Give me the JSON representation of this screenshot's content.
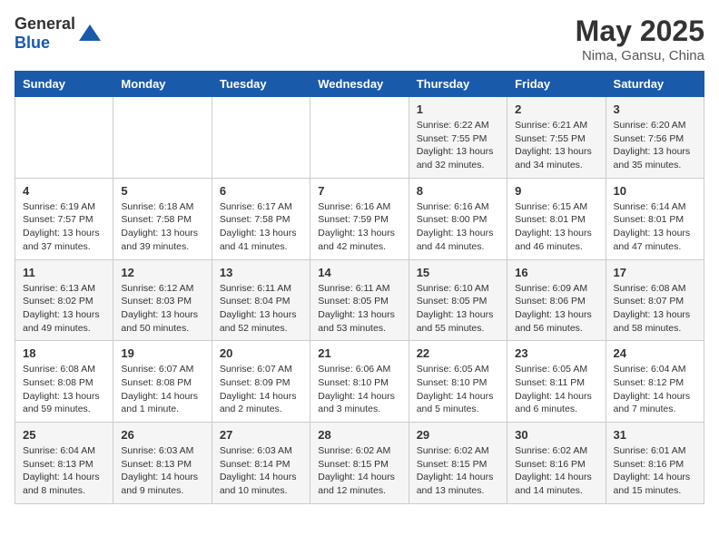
{
  "header": {
    "logo_general": "General",
    "logo_blue": "Blue",
    "month": "May 2025",
    "location": "Nima, Gansu, China"
  },
  "weekdays": [
    "Sunday",
    "Monday",
    "Tuesday",
    "Wednesday",
    "Thursday",
    "Friday",
    "Saturday"
  ],
  "weeks": [
    [
      {
        "day": "",
        "info": ""
      },
      {
        "day": "",
        "info": ""
      },
      {
        "day": "",
        "info": ""
      },
      {
        "day": "",
        "info": ""
      },
      {
        "day": "1",
        "info": "Sunrise: 6:22 AM\nSunset: 7:55 PM\nDaylight: 13 hours and 32 minutes."
      },
      {
        "day": "2",
        "info": "Sunrise: 6:21 AM\nSunset: 7:55 PM\nDaylight: 13 hours and 34 minutes."
      },
      {
        "day": "3",
        "info": "Sunrise: 6:20 AM\nSunset: 7:56 PM\nDaylight: 13 hours and 35 minutes."
      }
    ],
    [
      {
        "day": "4",
        "info": "Sunrise: 6:19 AM\nSunset: 7:57 PM\nDaylight: 13 hours and 37 minutes."
      },
      {
        "day": "5",
        "info": "Sunrise: 6:18 AM\nSunset: 7:58 PM\nDaylight: 13 hours and 39 minutes."
      },
      {
        "day": "6",
        "info": "Sunrise: 6:17 AM\nSunset: 7:58 PM\nDaylight: 13 hours and 41 minutes."
      },
      {
        "day": "7",
        "info": "Sunrise: 6:16 AM\nSunset: 7:59 PM\nDaylight: 13 hours and 42 minutes."
      },
      {
        "day": "8",
        "info": "Sunrise: 6:16 AM\nSunset: 8:00 PM\nDaylight: 13 hours and 44 minutes."
      },
      {
        "day": "9",
        "info": "Sunrise: 6:15 AM\nSunset: 8:01 PM\nDaylight: 13 hours and 46 minutes."
      },
      {
        "day": "10",
        "info": "Sunrise: 6:14 AM\nSunset: 8:01 PM\nDaylight: 13 hours and 47 minutes."
      }
    ],
    [
      {
        "day": "11",
        "info": "Sunrise: 6:13 AM\nSunset: 8:02 PM\nDaylight: 13 hours and 49 minutes."
      },
      {
        "day": "12",
        "info": "Sunrise: 6:12 AM\nSunset: 8:03 PM\nDaylight: 13 hours and 50 minutes."
      },
      {
        "day": "13",
        "info": "Sunrise: 6:11 AM\nSunset: 8:04 PM\nDaylight: 13 hours and 52 minutes."
      },
      {
        "day": "14",
        "info": "Sunrise: 6:11 AM\nSunset: 8:05 PM\nDaylight: 13 hours and 53 minutes."
      },
      {
        "day": "15",
        "info": "Sunrise: 6:10 AM\nSunset: 8:05 PM\nDaylight: 13 hours and 55 minutes."
      },
      {
        "day": "16",
        "info": "Sunrise: 6:09 AM\nSunset: 8:06 PM\nDaylight: 13 hours and 56 minutes."
      },
      {
        "day": "17",
        "info": "Sunrise: 6:08 AM\nSunset: 8:07 PM\nDaylight: 13 hours and 58 minutes."
      }
    ],
    [
      {
        "day": "18",
        "info": "Sunrise: 6:08 AM\nSunset: 8:08 PM\nDaylight: 13 hours and 59 minutes."
      },
      {
        "day": "19",
        "info": "Sunrise: 6:07 AM\nSunset: 8:08 PM\nDaylight: 14 hours and 1 minute."
      },
      {
        "day": "20",
        "info": "Sunrise: 6:07 AM\nSunset: 8:09 PM\nDaylight: 14 hours and 2 minutes."
      },
      {
        "day": "21",
        "info": "Sunrise: 6:06 AM\nSunset: 8:10 PM\nDaylight: 14 hours and 3 minutes."
      },
      {
        "day": "22",
        "info": "Sunrise: 6:05 AM\nSunset: 8:10 PM\nDaylight: 14 hours and 5 minutes."
      },
      {
        "day": "23",
        "info": "Sunrise: 6:05 AM\nSunset: 8:11 PM\nDaylight: 14 hours and 6 minutes."
      },
      {
        "day": "24",
        "info": "Sunrise: 6:04 AM\nSunset: 8:12 PM\nDaylight: 14 hours and 7 minutes."
      }
    ],
    [
      {
        "day": "25",
        "info": "Sunrise: 6:04 AM\nSunset: 8:13 PM\nDaylight: 14 hours and 8 minutes."
      },
      {
        "day": "26",
        "info": "Sunrise: 6:03 AM\nSunset: 8:13 PM\nDaylight: 14 hours and 9 minutes."
      },
      {
        "day": "27",
        "info": "Sunrise: 6:03 AM\nSunset: 8:14 PM\nDaylight: 14 hours and 10 minutes."
      },
      {
        "day": "28",
        "info": "Sunrise: 6:02 AM\nSunset: 8:15 PM\nDaylight: 14 hours and 12 minutes."
      },
      {
        "day": "29",
        "info": "Sunrise: 6:02 AM\nSunset: 8:15 PM\nDaylight: 14 hours and 13 minutes."
      },
      {
        "day": "30",
        "info": "Sunrise: 6:02 AM\nSunset: 8:16 PM\nDaylight: 14 hours and 14 minutes."
      },
      {
        "day": "31",
        "info": "Sunrise: 6:01 AM\nSunset: 8:16 PM\nDaylight: 14 hours and 15 minutes."
      }
    ]
  ]
}
